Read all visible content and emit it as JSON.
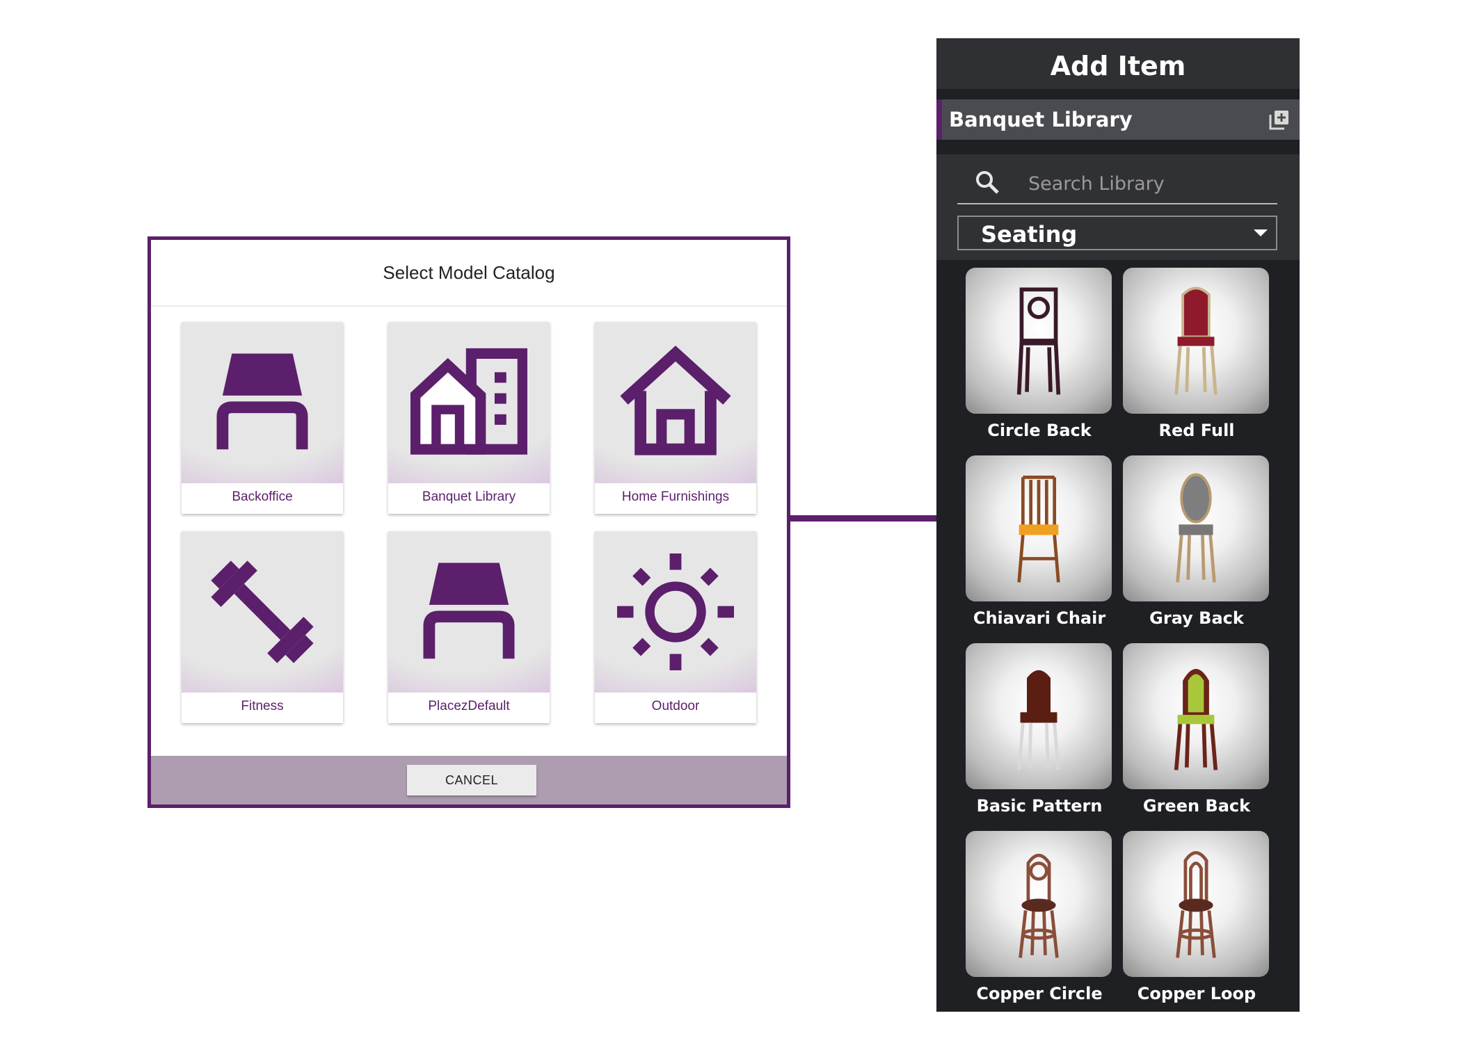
{
  "dialog": {
    "title": "Select Model Catalog",
    "catalogs": [
      {
        "label": "Backoffice",
        "icon": "chair-icon"
      },
      {
        "label": "Banquet Library",
        "icon": "buildings-icon"
      },
      {
        "label": "Home Furnishings",
        "icon": "home-icon"
      },
      {
        "label": "Fitness",
        "icon": "dumbbell-icon"
      },
      {
        "label": "PlacezDefault",
        "icon": "chair-icon"
      },
      {
        "label": "Outdoor",
        "icon": "sun-icon"
      }
    ],
    "cancel_label": "CANCEL"
  },
  "panel": {
    "title": "Add Item",
    "library_name": "Banquet Library",
    "search_placeholder": "Search Library",
    "category": "Seating",
    "items": [
      {
        "name": "Circle Back"
      },
      {
        "name": "Red Full"
      },
      {
        "name": "Chiavari Chair"
      },
      {
        "name": "Gray Back"
      },
      {
        "name": "Basic Pattern"
      },
      {
        "name": "Green Back"
      },
      {
        "name": "Copper Circle"
      },
      {
        "name": "Copper Loop"
      }
    ]
  },
  "colors": {
    "accent": "#5b1f6b",
    "dialog_footer": "#ae9db0",
    "panel_bg": "#1f2024"
  }
}
